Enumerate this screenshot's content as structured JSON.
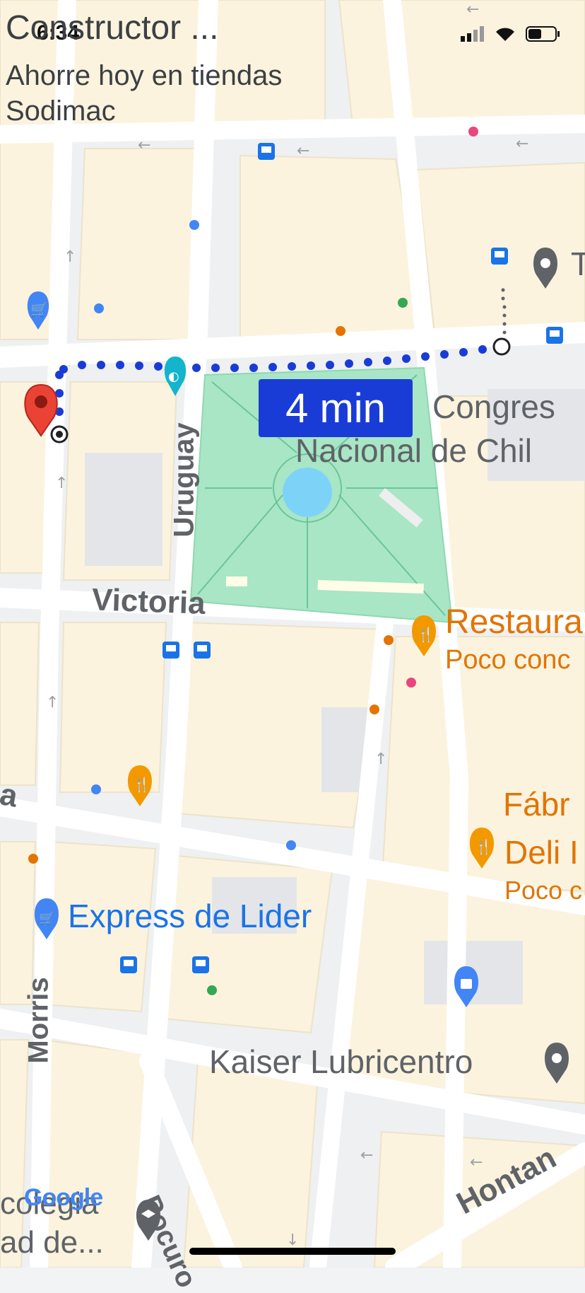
{
  "status_bar": {
    "time": "6:34"
  },
  "header_overlay": {
    "title": "Constructor ...",
    "subtitle_line1": "Ahorre hoy en tiendas",
    "subtitle_line2": "Sodimac"
  },
  "route": {
    "eta": "4 min",
    "color": "#1a3cd6"
  },
  "streets": {
    "uruguay": "Uruguay",
    "victoria": "Victoria",
    "morris": "Morris",
    "pocuro": "Pocuro",
    "hontan": "Hontan",
    "left_fragment": "a"
  },
  "places": {
    "congreso_line1": "Congres",
    "congreso_line2": "Nacional de Chil",
    "restaurant_name": "Restaura",
    "restaurant_sub": "Poco conc",
    "fabrica": "Fábr",
    "deli": "Deli I",
    "deli_sub": "Poco c",
    "express_lider": "Express de Lider",
    "kaiser": "Kaiser Lubricentro",
    "top_right_fragment": "T",
    "bottom_left_line1": "colegia",
    "bottom_left_line2": "ad de..."
  },
  "attribution": {
    "logo": "Google"
  },
  "colors": {
    "park": "#a8e6c5",
    "block": "#fdf6e3",
    "road": "#ffffff",
    "restaurant": "#e37400",
    "shop_blue": "#4285f4",
    "transit_blue": "#1a73e8",
    "pin_red": "#ea4335"
  }
}
